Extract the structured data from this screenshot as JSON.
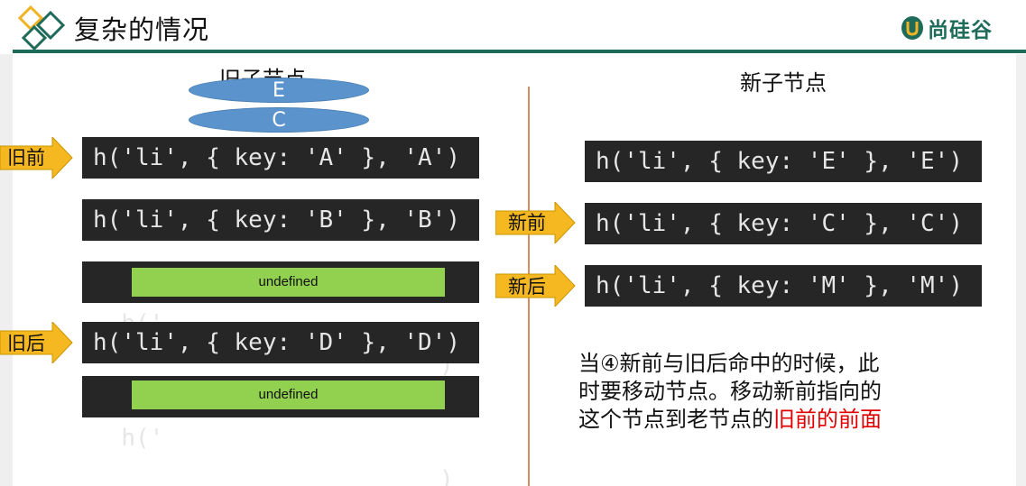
{
  "header": {
    "title": "复杂的情况",
    "brand": "尚硅谷"
  },
  "old_column": {
    "title": "旧子节点",
    "ellipses": [
      "E",
      "C"
    ],
    "rows": [
      {
        "code": "h('li', { key: 'A' }, 'A')",
        "overlay": ""
      },
      {
        "code": "h('li', { key: 'B' }, 'B')",
        "overlay": ""
      },
      {
        "code": "h('",
        "tail": ")",
        "overlay": "undefined"
      },
      {
        "code": "h('li', { key: 'D' }, 'D')",
        "overlay": ""
      },
      {
        "code": "h('",
        "tail": ")",
        "overlay": "undefined"
      }
    ],
    "arrows": [
      "旧前",
      "旧后"
    ]
  },
  "new_column": {
    "title": "新子节点",
    "rows": [
      {
        "code": "h('li', { key: 'E' }, 'E')"
      },
      {
        "code": "h('li', { key: 'C' }, 'C')"
      },
      {
        "code": "h('li', { key: 'M' }, 'M')"
      }
    ],
    "arrows": [
      "新前",
      "新后"
    ]
  },
  "note": {
    "line1": "当④新前与旧后命中的时候，此",
    "line2": "时要移动节点。移动新前指向的",
    "line3_plain": "这个节点到老节点的",
    "line3_highlight": "旧前的前面"
  },
  "colors": {
    "accent": "#1f6b5a",
    "code_bg": "#262626",
    "overlay": "#92d050",
    "ellipse": "#5b94cd",
    "arrow": "#f5b820",
    "divider": "#d98b5e",
    "highlight": "#e00000"
  }
}
